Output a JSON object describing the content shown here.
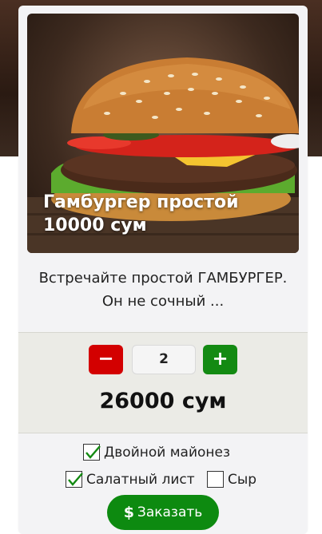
{
  "product": {
    "title_line1": "Гамбургер простой",
    "title_line2": "10000 сум",
    "description": "Встречайте простой ГАМБУРГЕР. Он не сочный ..."
  },
  "order": {
    "minus_label": "−",
    "plus_label": "+",
    "quantity": "2",
    "total": "26000 сум"
  },
  "options": [
    {
      "label": "Двойной майонез",
      "checked": true
    },
    {
      "label": "Салатный лист",
      "checked": true
    },
    {
      "label": "Сыр",
      "checked": false
    }
  ],
  "order_button": {
    "icon": "dollar-icon",
    "label": "Заказать"
  },
  "colors": {
    "minus": "#d30000",
    "plus": "#138a12",
    "order_button": "#0d8a10",
    "check": "#138a12"
  }
}
